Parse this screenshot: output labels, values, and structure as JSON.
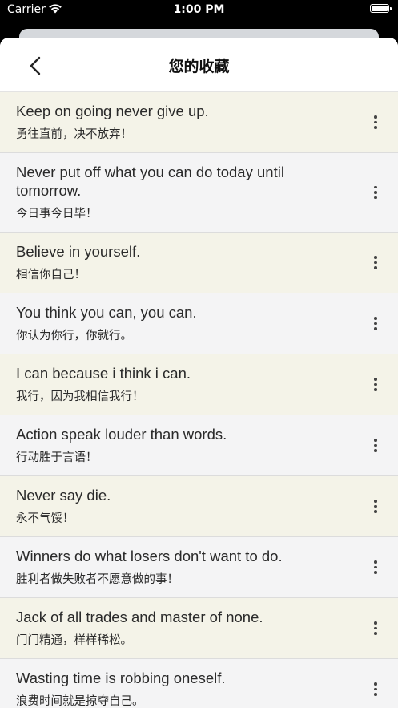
{
  "status_bar": {
    "carrier": "Carrier",
    "time": "1:00 PM"
  },
  "nav": {
    "title": "您的收藏",
    "back_icon": "chevron-left-icon"
  },
  "colors": {
    "row_odd": "#f4f3e8",
    "row_even": "#f4f4f5",
    "text": "#2a2a2a"
  },
  "quotes": [
    {
      "en": "Keep on going never give up.",
      "zh": "勇往直前，决不放弃！"
    },
    {
      "en": "Never put off what you can do today until tomorrow.",
      "zh": "今日事今日毕！"
    },
    {
      "en": "Believe in yourself.",
      "zh": "相信你自己！"
    },
    {
      "en": "You think you can, you can.",
      "zh": "你认为你行，你就行。"
    },
    {
      "en": "I can because i think i can.",
      "zh": "我行，因为我相信我行！"
    },
    {
      "en": "Action speak louder than words.",
      "zh": "行动胜于言语！"
    },
    {
      "en": "Never say die.",
      "zh": "永不气馁！"
    },
    {
      "en": "Winners do what losers don't want to do.",
      "zh": "胜利者做失败者不愿意做的事！"
    },
    {
      "en": "Jack of all trades and master of none.",
      "zh": "门门精通，样样稀松。"
    },
    {
      "en": "Wasting time is robbing oneself.",
      "zh": "浪费时间就是掠夺自己。"
    }
  ]
}
